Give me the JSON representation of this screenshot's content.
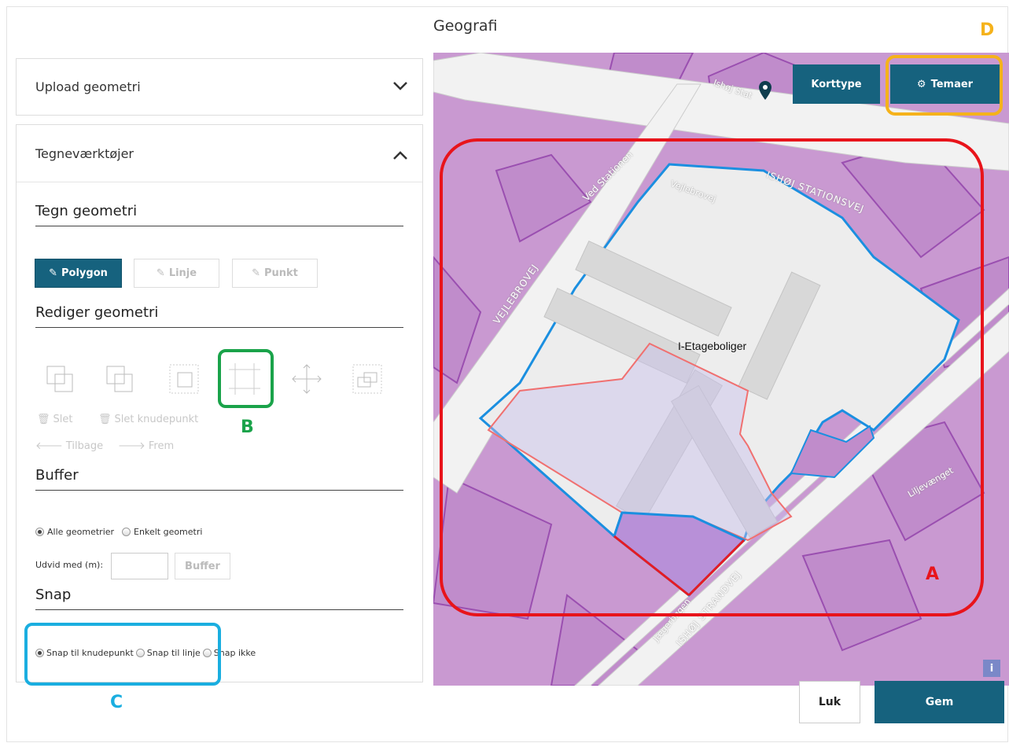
{
  "dialog": {
    "title": "Geografi"
  },
  "upload_panel": {
    "label": "Upload geometri"
  },
  "draw_panel": {
    "label": "Tegneværktøjer"
  },
  "draw": {
    "title": "Tegn geometri",
    "polygon_label": "Polygon",
    "line_label": "Linje",
    "point_label": "Punkt"
  },
  "edit": {
    "title": "Rediger geometri",
    "delete_label": "Slet",
    "delete_node_label": "Slet knudepunkt",
    "back_label": "Tilbage",
    "forward_label": "Frem"
  },
  "buffer": {
    "title": "Buffer",
    "all_label": "Alle geometrier",
    "single_label": "Enkelt geometri",
    "expand_label": "Udvid med (m):",
    "expand_value": "",
    "button_label": "Buffer"
  },
  "snap": {
    "title": "Snap",
    "node_label": "Snap til knudepunkt",
    "line_label": "Snap til linje",
    "none_label": "Snap ikke"
  },
  "map": {
    "maptype_label": "Korttype",
    "themes_label": "Temaer",
    "feature_label": "I-Etageboliger",
    "streets": [
      "Ishøj Stationsvej",
      "Vejlebrovej",
      "Ved Stationen",
      "VEJLEBROVEJ",
      "ISHØJ STATIONSVEJ",
      "ISHØJ STRANDVEJ",
      "Jægerbøgen",
      "Liljevænget",
      "Ishøj Stat"
    ],
    "info_label": "i"
  },
  "annotations": {
    "a": "A",
    "b": "B",
    "c": "C",
    "d": "D"
  },
  "colors": {
    "primary": "#16627e",
    "anno_a": "#e8141b",
    "anno_b": "#1aa34a",
    "anno_c": "#1aaee0",
    "anno_d": "#f5b21b"
  },
  "footer": {
    "close_label": "Luk",
    "save_label": "Gem"
  }
}
